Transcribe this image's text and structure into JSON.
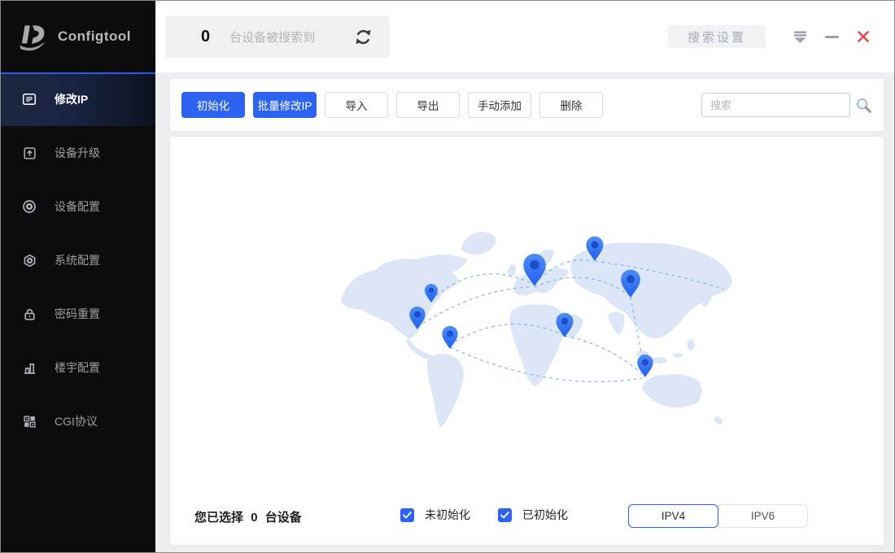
{
  "sidebar": {
    "logo_text": "Configtool",
    "items": [
      {
        "label": "修改IP",
        "icon": "ip-badge-icon",
        "active": true
      },
      {
        "label": "设备升级",
        "icon": "upload-box-icon",
        "active": false
      },
      {
        "label": "设备配置",
        "icon": "target-icon",
        "active": false
      },
      {
        "label": "系统配置",
        "icon": "gear-hex-icon",
        "active": false
      },
      {
        "label": "密码重置",
        "icon": "lock-icon",
        "active": false
      },
      {
        "label": "楼宇配置",
        "icon": "building-icon",
        "active": false
      },
      {
        "label": "CGI协议",
        "icon": "grid-icon",
        "active": false
      }
    ]
  },
  "header": {
    "device_count": "0",
    "device_count_suffix": "台设备被搜索到",
    "search_settings_label": "搜索设置",
    "icons": [
      "refresh-icon",
      "collapse-icon",
      "minimize-icon",
      "close-icon"
    ]
  },
  "toolbar": {
    "buttons": [
      {
        "label": "初始化",
        "style": "primary"
      },
      {
        "label": "批量修改IP",
        "style": "primary"
      },
      {
        "label": "导入",
        "style": "default"
      },
      {
        "label": "导出",
        "style": "default"
      },
      {
        "label": "手动添加",
        "style": "default"
      },
      {
        "label": "删除",
        "style": "default"
      }
    ],
    "search_placeholder": "搜索",
    "search_value": "",
    "search_icon": "magnifier-icon"
  },
  "footer": {
    "selected_prefix": "您已选择",
    "selected_count": "0",
    "selected_suffix": "台设备",
    "checkboxes": [
      {
        "label": "未初始化",
        "checked": true
      },
      {
        "label": "已初始化",
        "checked": true
      }
    ],
    "ip_tabs": [
      {
        "label": "IPV4",
        "selected": true
      },
      {
        "label": "IPV6",
        "selected": false
      }
    ]
  },
  "colors": {
    "accent_blue": "#2c63f3",
    "close_red": "#e5484d",
    "sidebar_bg": "#0c0c0c",
    "map_land": "#dce6f7",
    "map_route": "#8ab5ea",
    "pin_blue": "#2f6ff2"
  }
}
